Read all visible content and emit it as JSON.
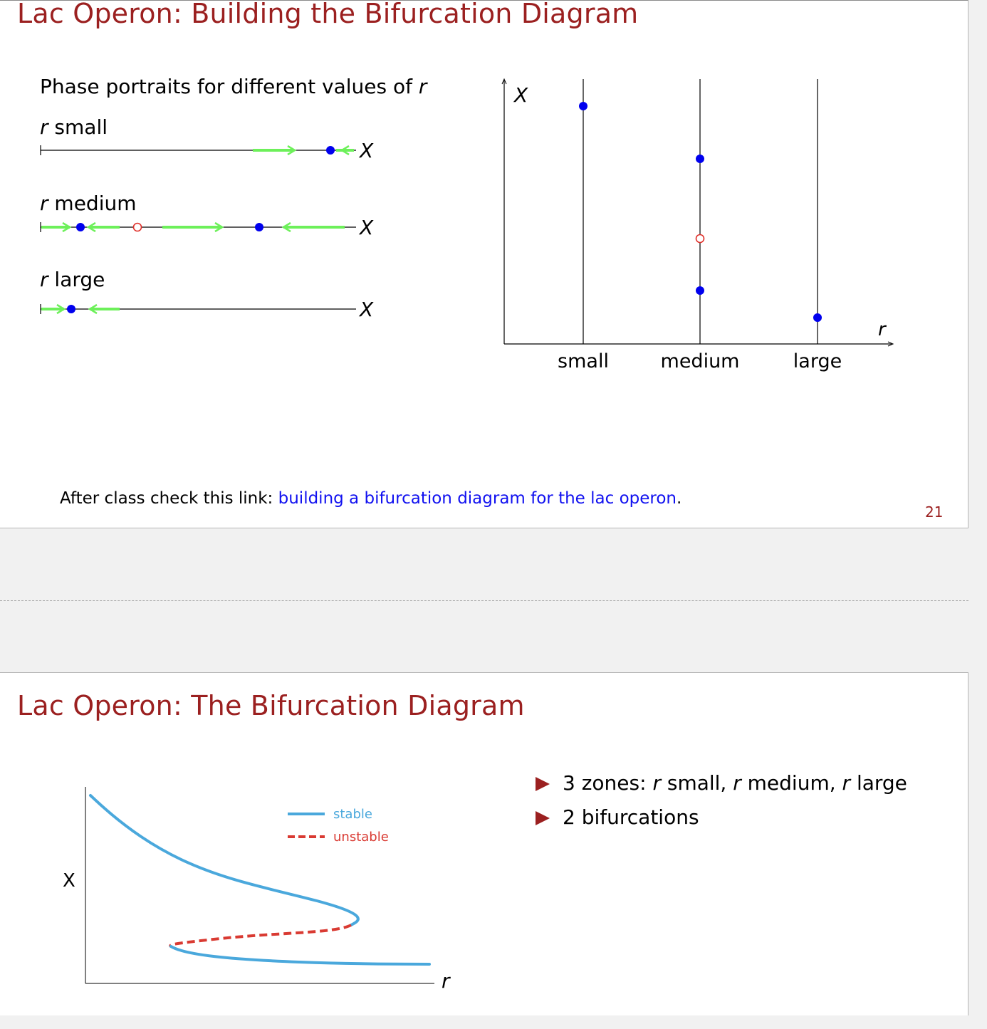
{
  "slide1": {
    "title": "Lac Operon: Building the Bifurcation Diagram",
    "phase_heading": "Phase portraits for different values of ",
    "phase_heading_var": "r",
    "portraits": [
      {
        "var": "r",
        "label": " small",
        "axis_label": "X"
      },
      {
        "var": "r",
        "label": " medium",
        "axis_label": "X"
      },
      {
        "var": "r",
        "label": " large",
        "axis_label": "X"
      }
    ],
    "diagram": {
      "y_label": "X",
      "x_label": "r",
      "categories": [
        "small",
        "medium",
        "large"
      ]
    },
    "footer_prefix": "After class check this link: ",
    "footer_link": "building a bifurcation diagram for the lac operon",
    "footer_suffix": ".",
    "page_number": "21"
  },
  "slide2": {
    "title": "Lac Operon: The Bifurcation Diagram",
    "chart_y_label": "X",
    "chart_x_label": "r",
    "legend_stable": "stable",
    "legend_unstable": "unstable",
    "bullets": [
      {
        "prefix": "3 zones: ",
        "v1": "r",
        "t1": " small, ",
        "v2": "r",
        "t2": " medium, ",
        "v3": "r",
        "t3": " large"
      },
      {
        "text": "2 bifurcations"
      }
    ]
  },
  "colors": {
    "title": "#9b2020",
    "flow_arrow": "#6df05a",
    "stable_point": "#0000ee",
    "unstable_point": "#e0302a",
    "stable_curve": "#4aa8dc",
    "unstable_curve": "#d93a32",
    "link": "#1010f0"
  }
}
